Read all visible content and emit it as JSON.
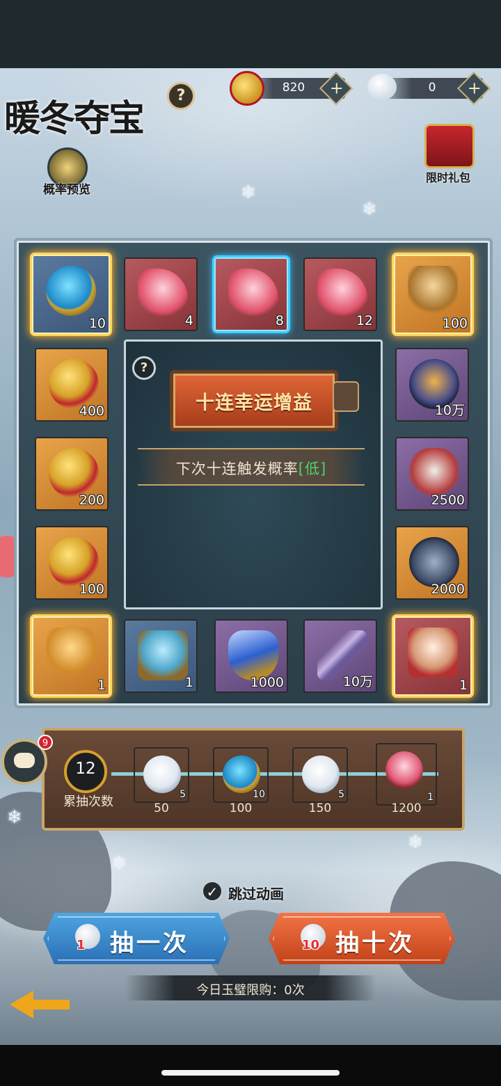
{
  "title": "暖冬夺宝",
  "currencies": [
    {
      "name": "coin-chip",
      "value": "820"
    },
    {
      "name": "snowball",
      "value": "0"
    }
  ],
  "top_buttons": {
    "probability_preview": "概率预览",
    "limited_gift": "限时礼包"
  },
  "board": {
    "top_row": [
      {
        "item": "blue-orb",
        "count": "10",
        "style": "blue",
        "glow": true
      },
      {
        "item": "crystal",
        "count": "4",
        "style": "red"
      },
      {
        "item": "crystal",
        "count": "8",
        "style": "red",
        "selected": true
      },
      {
        "item": "crystal",
        "count": "12",
        "style": "red"
      },
      {
        "item": "chest",
        "count": "100",
        "style": "gold",
        "glow": true
      }
    ],
    "left_col": [
      {
        "item": "coins",
        "count": "400",
        "style": "gold"
      },
      {
        "item": "coins",
        "count": "200",
        "style": "gold"
      },
      {
        "item": "coins",
        "count": "100",
        "style": "gold"
      }
    ],
    "right_col": [
      {
        "item": "ball",
        "count": "10万",
        "style": "purple"
      },
      {
        "item": "tiger",
        "count": "2500",
        "style": "purple"
      },
      {
        "item": "disc",
        "count": "2000",
        "style": "gold"
      }
    ],
    "bottom_row": [
      {
        "item": "gold-chest",
        "count": "1",
        "style": "gold",
        "glow": true
      },
      {
        "item": "blue-chest",
        "count": "1",
        "style": "blue"
      },
      {
        "item": "gem",
        "count": "1000",
        "style": "purple"
      },
      {
        "item": "dagger",
        "count": "10万",
        "style": "purple"
      },
      {
        "item": "red-chest",
        "count": "1",
        "style": "red",
        "glow": true
      }
    ]
  },
  "center": {
    "banner": "十连幸运增益",
    "prob_prefix": "下次十连触发概率",
    "prob_level": "[低]",
    "prob_level_color": "#4ed36d"
  },
  "track": {
    "count": "12",
    "count_label": "累抽次数",
    "milestones": [
      {
        "item": "snowball",
        "count": "5",
        "threshold": "50",
        "style": "gold"
      },
      {
        "item": "blue-orb",
        "count": "10",
        "threshold": "100",
        "style": "blue"
      },
      {
        "item": "snowball",
        "count": "5",
        "threshold": "150",
        "style": "gold"
      },
      {
        "item": "pink-chest",
        "count": "1",
        "threshold": "1200",
        "style": "red"
      }
    ]
  },
  "chat_badge": "9",
  "skip_animation": {
    "label": "跳过动画",
    "checked": true
  },
  "draw_once": {
    "label": "抽一次",
    "cost": "1"
  },
  "draw_ten": {
    "label": "抽十次",
    "cost": "10"
  },
  "daily_limit": "今日玉璧限购：0次",
  "colors": {
    "draw_once": "#2a6fb5",
    "draw_ten": "#c24218",
    "glow": "#ffd45c",
    "selected": "#3fd0ff"
  }
}
